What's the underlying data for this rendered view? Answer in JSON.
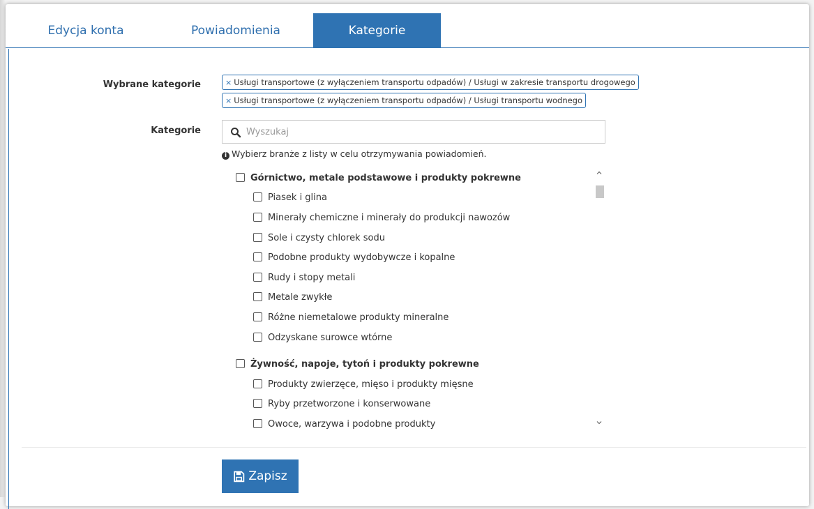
{
  "tabs": [
    {
      "label": "Edycja konta",
      "active": false
    },
    {
      "label": "Powiadomienia",
      "active": false
    },
    {
      "label": "Kategorie",
      "active": true
    }
  ],
  "selected": {
    "label": "Wybrane kategorie",
    "remove_glyph": "×",
    "chips": [
      "Usługi transportowe (z wyłączeniem transportu odpadów) / Usługi w zakresie transportu drogowego",
      "Usługi transportowe (z wyłączeniem transportu odpadów) / Usługi transportu wodnego"
    ]
  },
  "categories": {
    "label": "Kategorie",
    "search_placeholder": "Wyszukaj",
    "hint": "Wybierz branże z listy w celu otrzymywania powiadomień.",
    "info_glyph": "i",
    "groups": [
      {
        "name": "Górnictwo, metale podstawowe i produkty pokrewne",
        "checked": false,
        "items": [
          {
            "name": "Piasek i glina",
            "checked": false
          },
          {
            "name": "Minerały chemiczne i minerały do produkcji nawozów",
            "checked": false
          },
          {
            "name": "Sole i czysty chlorek sodu",
            "checked": false
          },
          {
            "name": "Podobne produkty wydobywcze i kopalne",
            "checked": false
          },
          {
            "name": "Rudy i stopy metali",
            "checked": false
          },
          {
            "name": "Metale zwykłe",
            "checked": false
          },
          {
            "name": "Różne niemetalowe produkty mineralne",
            "checked": false
          },
          {
            "name": "Odzyskane surowce wtórne",
            "checked": false
          }
        ]
      },
      {
        "name": "Żywność, napoje, tytoń i produkty pokrewne",
        "checked": false,
        "items": [
          {
            "name": "Produkty zwierzęce, mięso i produkty mięsne",
            "checked": false
          },
          {
            "name": "Ryby przetworzone i konserwowane",
            "checked": false
          },
          {
            "name": "Owoce, warzywa i podobne produkty",
            "checked": false
          }
        ]
      }
    ]
  },
  "save_button": {
    "label": "Zapisz",
    "icon": "save-icon"
  },
  "colors": {
    "accent": "#2f73b3",
    "text": "#333333",
    "muted": "#999999"
  }
}
